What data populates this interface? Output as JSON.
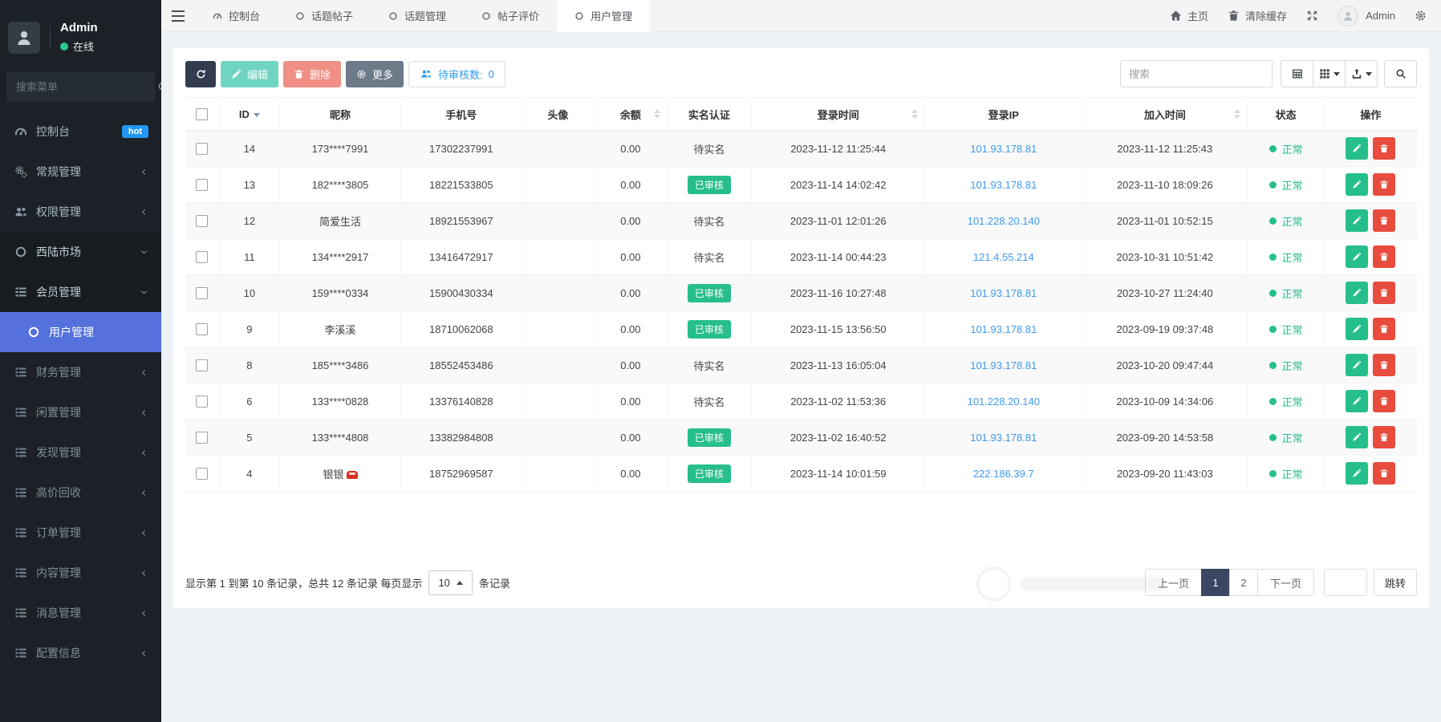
{
  "sidebar": {
    "user": {
      "name": "Admin",
      "status": "在线"
    },
    "search_placeholder": "搜索菜单",
    "items": [
      {
        "label": "控制台",
        "icon": "dashboard-icon",
        "badge": "hot"
      },
      {
        "label": "常规管理",
        "icon": "gears-icon",
        "chevron": "left"
      },
      {
        "label": "权限管理",
        "icon": "users-icon",
        "chevron": "left"
      },
      {
        "label": "西陆市场",
        "icon": "circle-icon",
        "chevron": "down",
        "expanded": true
      },
      {
        "label": "会员管理",
        "icon": "list-icon",
        "chevron": "down",
        "expanded": true
      },
      {
        "label": "用户管理",
        "icon": "circle-icon",
        "sub": true,
        "active": true
      },
      {
        "label": "财务管理",
        "icon": "list-icon",
        "chevron": "left",
        "dim": true
      },
      {
        "label": "闲置管理",
        "icon": "list-icon",
        "chevron": "left",
        "dim": true
      },
      {
        "label": "发现管理",
        "icon": "list-icon",
        "chevron": "left",
        "dim": true
      },
      {
        "label": "高价回收",
        "icon": "list-icon",
        "chevron": "left",
        "dim": true
      },
      {
        "label": "订单管理",
        "icon": "list-icon",
        "chevron": "left",
        "dim": true
      },
      {
        "label": "内容管理",
        "icon": "list-icon",
        "chevron": "left",
        "dim": true
      },
      {
        "label": "消息管理",
        "icon": "list-icon",
        "chevron": "left",
        "dim": true
      },
      {
        "label": "配置信息",
        "icon": "list-icon",
        "chevron": "left",
        "dim": true
      }
    ]
  },
  "topbar": {
    "tabs": [
      {
        "label": "控制台",
        "icon": "dashboard-icon"
      },
      {
        "label": "话题帖子",
        "icon": "circle-icon"
      },
      {
        "label": "话题管理",
        "icon": "circle-icon"
      },
      {
        "label": "帖子评价",
        "icon": "circle-icon"
      },
      {
        "label": "用户管理",
        "icon": "circle-icon",
        "active": true
      }
    ],
    "right": {
      "home": "主页",
      "clear_cache": "清除缓存",
      "user_name": "Admin"
    }
  },
  "toolbar": {
    "edit_label": "编辑",
    "delete_label": "删除",
    "more_label": "更多",
    "pending_label": "待审核数:",
    "pending_count": "0",
    "search_placeholder": "搜索"
  },
  "table": {
    "columns": [
      {
        "label": "ID",
        "sort": "active"
      },
      {
        "label": "昵称"
      },
      {
        "label": "手机号"
      },
      {
        "label": "头像"
      },
      {
        "label": "余额",
        "sort": "both"
      },
      {
        "label": "实名认证"
      },
      {
        "label": "登录时间",
        "sort": "both"
      },
      {
        "label": "登录IP"
      },
      {
        "label": "加入时间",
        "sort": "both"
      },
      {
        "label": "状态"
      },
      {
        "label": "操作"
      }
    ],
    "rows": [
      {
        "id": "14",
        "nickname": "173****7991",
        "phone": "17302237991",
        "avatar": "",
        "balance": "0.00",
        "verify": "待实名",
        "verified": false,
        "login_time": "2023-11-12 11:25:44",
        "login_ip": "101.93.178.81",
        "join_time": "2023-11-12 11:25:43",
        "status": "正常"
      },
      {
        "id": "13",
        "nickname": "182****3805",
        "phone": "18221533805",
        "avatar": "",
        "balance": "0.00",
        "verify": "已审核",
        "verified": true,
        "login_time": "2023-11-14 14:02:42",
        "login_ip": "101.93.178.81",
        "join_time": "2023-11-10 18:09:26",
        "status": "正常"
      },
      {
        "id": "12",
        "nickname": "简爱生活",
        "phone": "18921553967",
        "avatar": "",
        "balance": "0.00",
        "verify": "待实名",
        "verified": false,
        "login_time": "2023-11-01 12:01:26",
        "login_ip": "101.228.20.140",
        "join_time": "2023-11-01 10:52:15",
        "status": "正常"
      },
      {
        "id": "11",
        "nickname": "134****2917",
        "phone": "13416472917",
        "avatar": "",
        "balance": "0.00",
        "verify": "待实名",
        "verified": false,
        "login_time": "2023-11-14 00:44:23",
        "login_ip": "121.4.55.214",
        "join_time": "2023-10-31 10:51:42",
        "status": "正常"
      },
      {
        "id": "10",
        "nickname": "159****0334",
        "phone": "15900430334",
        "avatar": "",
        "balance": "0.00",
        "verify": "已审核",
        "verified": true,
        "login_time": "2023-11-16 10:27:48",
        "login_ip": "101.93.178.81",
        "join_time": "2023-10-27 11:24:40",
        "status": "正常"
      },
      {
        "id": "9",
        "nickname": "李溪溪",
        "phone": "18710062068",
        "avatar": "",
        "balance": "0.00",
        "verify": "已审核",
        "verified": true,
        "login_time": "2023-11-15 13:56:50",
        "login_ip": "101.93.178.81",
        "join_time": "2023-09-19 09:37:48",
        "status": "正常"
      },
      {
        "id": "8",
        "nickname": "185****3486",
        "phone": "18552453486",
        "avatar": "",
        "balance": "0.00",
        "verify": "待实名",
        "verified": false,
        "login_time": "2023-11-13 16:05:04",
        "login_ip": "101.93.178.81",
        "join_time": "2023-10-20 09:47:44",
        "status": "正常"
      },
      {
        "id": "6",
        "nickname": "133****0828",
        "phone": "13376140828",
        "avatar": "",
        "balance": "0.00",
        "verify": "待实名",
        "verified": false,
        "login_time": "2023-11-02 11:53:36",
        "login_ip": "101.228.20.140",
        "join_time": "2023-10-09 14:34:06",
        "status": "正常"
      },
      {
        "id": "5",
        "nickname": "133****4808",
        "phone": "13382984808",
        "avatar": "",
        "balance": "0.00",
        "verify": "已审核",
        "verified": true,
        "login_time": "2023-11-02 16:40:52",
        "login_ip": "101.93.178.81",
        "join_time": "2023-09-20 14:53:58",
        "status": "正常"
      },
      {
        "id": "4",
        "nickname": "银银",
        "nickname_icon": "red-car-emoji",
        "phone": "18752969587",
        "avatar": "",
        "balance": "0.00",
        "verify": "已审核",
        "verified": true,
        "login_time": "2023-11-14 10:01:59",
        "login_ip": "222.186.39.7",
        "join_time": "2023-09-20 11:43:03",
        "status": "正常"
      }
    ]
  },
  "footer": {
    "summary": "显示第 1 到第 10 条记录，总共 12 条记录 每页显示",
    "page_size": "10",
    "suffix": "条记录",
    "prev": "上一页",
    "pages": [
      "1",
      "2"
    ],
    "active_page": "1",
    "next": "下一页",
    "jump": "跳转"
  },
  "colors": {
    "sidebar_bg": "#1b2126",
    "sidebar_active": "#5571dc",
    "hot_badge": "#2196f3",
    "success": "#18bc9c",
    "danger": "#e74c3c",
    "dark_button": "#333b4f",
    "more_button": "#6c7a89",
    "pending_blue": "#2d9cf0",
    "badge_green": "#26be8d",
    "ip_link": "#3d9af0",
    "pagination_active": "#3b4661"
  }
}
